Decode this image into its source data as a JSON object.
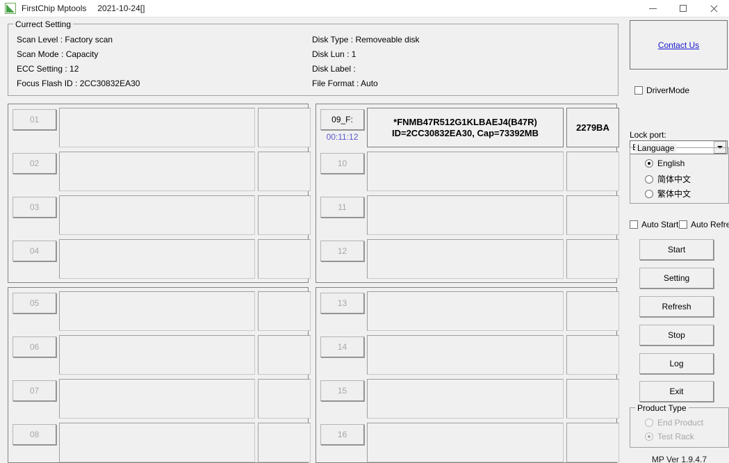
{
  "window": {
    "title": "FirstChip Mptools",
    "date": "2021-10-24[]",
    "app_icon": "green-flag-icon",
    "minimize": "minimize-icon",
    "maximize": "maximize-icon",
    "close": "close-icon"
  },
  "current_setting": {
    "group_title": "Currect Setting",
    "left_lines": [
      "Scan Level : Factory scan",
      "Scan Mode : Capacity",
      "ECC Setting : 12",
      "Focus Flash ID : 2CC30832EA30"
    ],
    "right_lines": [
      "Disk Type : Removeable disk",
      "Disk Lun : 1",
      "Disk Label :",
      "File Format : Auto"
    ]
  },
  "ports": {
    "quad1": [
      {
        "label": "01",
        "timer": "",
        "info": "",
        "code": "",
        "active": false
      },
      {
        "label": "02",
        "timer": "",
        "info": "",
        "code": "",
        "active": false
      },
      {
        "label": "03",
        "timer": "",
        "info": "",
        "code": "",
        "active": false
      },
      {
        "label": "04",
        "timer": "",
        "info": "",
        "code": "",
        "active": false
      }
    ],
    "quad2": [
      {
        "label": "09_F:",
        "timer": "00:11:12",
        "info": "*FNMB47R512G1KLBAEJ4(B47R)\nID=2CC30832EA30, Cap=73392MB",
        "code": "2279BA",
        "active": true
      },
      {
        "label": "10",
        "timer": "",
        "info": "",
        "code": "",
        "active": false
      },
      {
        "label": "11",
        "timer": "",
        "info": "",
        "code": "",
        "active": false
      },
      {
        "label": "12",
        "timer": "",
        "info": "",
        "code": "",
        "active": false
      }
    ],
    "quad3": [
      {
        "label": "05",
        "timer": "",
        "info": "",
        "code": "",
        "active": false
      },
      {
        "label": "06",
        "timer": "",
        "info": "",
        "code": "",
        "active": false
      },
      {
        "label": "07",
        "timer": "",
        "info": "",
        "code": "",
        "active": false
      },
      {
        "label": "08",
        "timer": "",
        "info": "",
        "code": "",
        "active": false
      }
    ],
    "quad4": [
      {
        "label": "13",
        "timer": "",
        "info": "",
        "code": "",
        "active": false
      },
      {
        "label": "14",
        "timer": "",
        "info": "",
        "code": "",
        "active": false
      },
      {
        "label": "15",
        "timer": "",
        "info": "",
        "code": "",
        "active": false
      },
      {
        "label": "16",
        "timer": "",
        "info": "",
        "code": "",
        "active": false
      }
    ]
  },
  "right_panel": {
    "contact_link": "Contact Us",
    "driver_mode": {
      "label": "DriverMode",
      "checked": false
    },
    "lock_port": {
      "label": "Lock port:",
      "selected": "Board order",
      "options": [
        "Board order"
      ]
    },
    "language": {
      "group_title": "Language",
      "options": [
        {
          "label": "English",
          "checked": true
        },
        {
          "label": "简体中文",
          "checked": false
        },
        {
          "label": "繁体中文",
          "checked": false
        }
      ]
    },
    "auto_start": {
      "label": "Auto Start",
      "checked": false
    },
    "auto_refresh": {
      "label": "Auto Refresh",
      "checked": false
    },
    "buttons": [
      {
        "label": "Start"
      },
      {
        "label": "Setting"
      },
      {
        "label": "Refresh"
      },
      {
        "label": "Stop"
      },
      {
        "label": "Log"
      },
      {
        "label": "Exit"
      }
    ],
    "product_type": {
      "group_title": "Product Type",
      "options": [
        {
          "label": "End Product",
          "checked": false,
          "disabled": true
        },
        {
          "label": "Test Rack",
          "checked": true,
          "disabled": true
        }
      ]
    },
    "version": "MP Ver 1.9.4.7"
  },
  "colors": {
    "background": "#f0f0f0",
    "link": "#1515d0",
    "timer": "#5a5acd",
    "disabled_text": "#a7a7a7",
    "border": "#828282"
  }
}
